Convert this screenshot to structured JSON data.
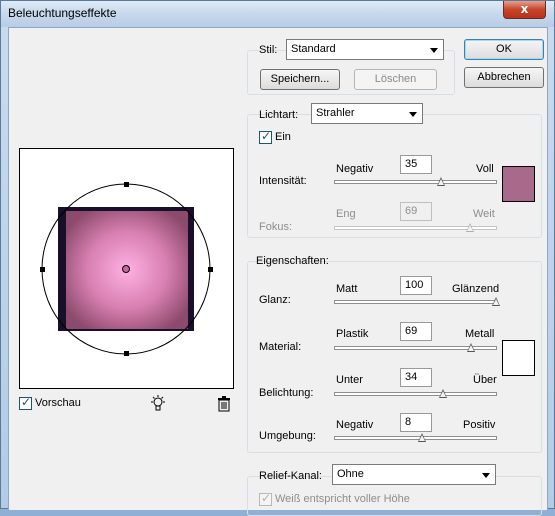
{
  "window": {
    "title": "Beleuchtungseffekte",
    "close_glyph": "x"
  },
  "style_group": {
    "label": "Stil:",
    "value": "Standard",
    "save_button": "Speichern...",
    "delete_button": "Löschen"
  },
  "buttons": {
    "ok": "OK",
    "cancel": "Abbrechen"
  },
  "light_type": {
    "label": "Lichtart:",
    "value": "Strahler",
    "on_label": "Ein",
    "on_checked": true,
    "intensity": {
      "label": "Intensität:",
      "min_label": "Negativ",
      "max_label": "Voll",
      "value": "35",
      "fraction": 0.66
    },
    "focus": {
      "label": "Fokus:",
      "min_label": "Eng",
      "max_label": "Weit",
      "value": "69",
      "fraction": 0.84
    },
    "light_color": "#a86a8a"
  },
  "properties": {
    "label": "Eigenschaften:",
    "gloss": {
      "label": "Glanz:",
      "min_label": "Matt",
      "max_label": "Glänzend",
      "value": "100",
      "fraction": 1.0
    },
    "material": {
      "label": "Material:",
      "min_label": "Plastik",
      "max_label": "Metall",
      "value": "69",
      "fraction": 0.845
    },
    "exposure": {
      "label": "Belichtung:",
      "min_label": "Unter",
      "max_label": "Über",
      "value": "34",
      "fraction": 0.67
    },
    "ambience": {
      "label": "Umgebung:",
      "min_label": "Negativ",
      "max_label": "Positiv",
      "value": "8",
      "fraction": 0.54
    },
    "surface_color": "#ffffff"
  },
  "relief": {
    "label": "Relief-Kanal:",
    "value": "Ohne",
    "white_is_high_label": "Weiß entspricht voller Höhe"
  },
  "preview": {
    "checkbox_label": "Vorschau",
    "checked": true,
    "light_glyph": "lightbulb-icon",
    "trash_glyph": "trash-icon"
  }
}
